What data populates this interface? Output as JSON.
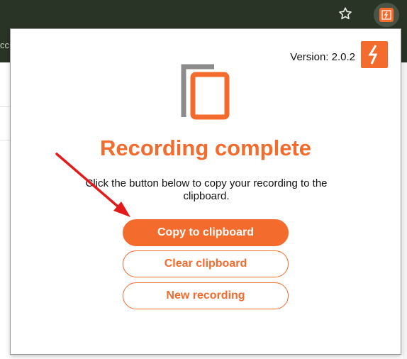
{
  "browser": {
    "bookmark_fragment": "cc"
  },
  "popup": {
    "version_label": "Version: 2.0.2",
    "title": "Recording complete",
    "description": "Click the button below to copy your recording to the clipboard.",
    "buttons": {
      "copy": "Copy to clipboard",
      "clear": "Clear clipboard",
      "new": "New recording"
    }
  },
  "colors": {
    "accent": "#f36b2d",
    "toolbar": "#2a3426",
    "annotation_arrow": "#e11b1b"
  },
  "icons": {
    "star": "star-icon",
    "extension": "lightning-icon",
    "copy": "copy-icon"
  }
}
